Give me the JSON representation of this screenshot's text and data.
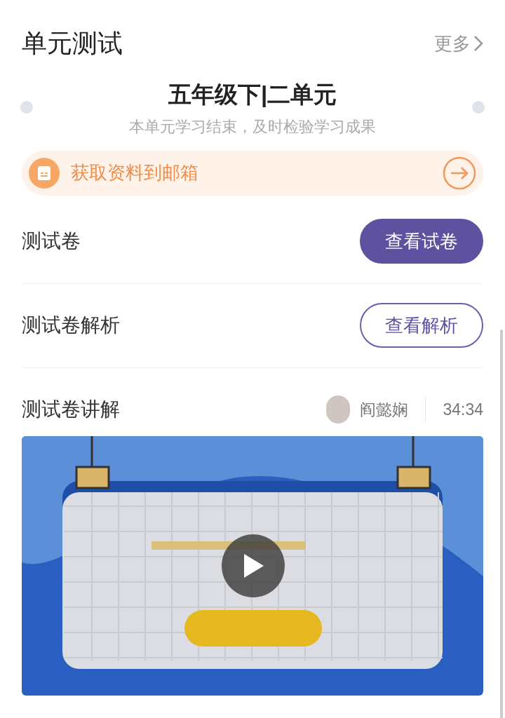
{
  "section": {
    "title": "单元测试",
    "more": "更多"
  },
  "unit": {
    "title": "五年级下|二单元",
    "subtitle": "本单元学习结束，及时检验学习成果"
  },
  "banner": {
    "label": "获取资料到邮箱"
  },
  "rows": [
    {
      "kind": "button",
      "label": "测试卷",
      "button": {
        "label": "查看试卷",
        "kind": "filled"
      }
    },
    {
      "kind": "button",
      "label": "测试卷解析",
      "button": {
        "label": "查看解析",
        "kind": "outline"
      }
    },
    {
      "kind": "video",
      "label": "测试卷讲解",
      "teacher": "阎懿娴",
      "duration": "34:34"
    }
  ]
}
